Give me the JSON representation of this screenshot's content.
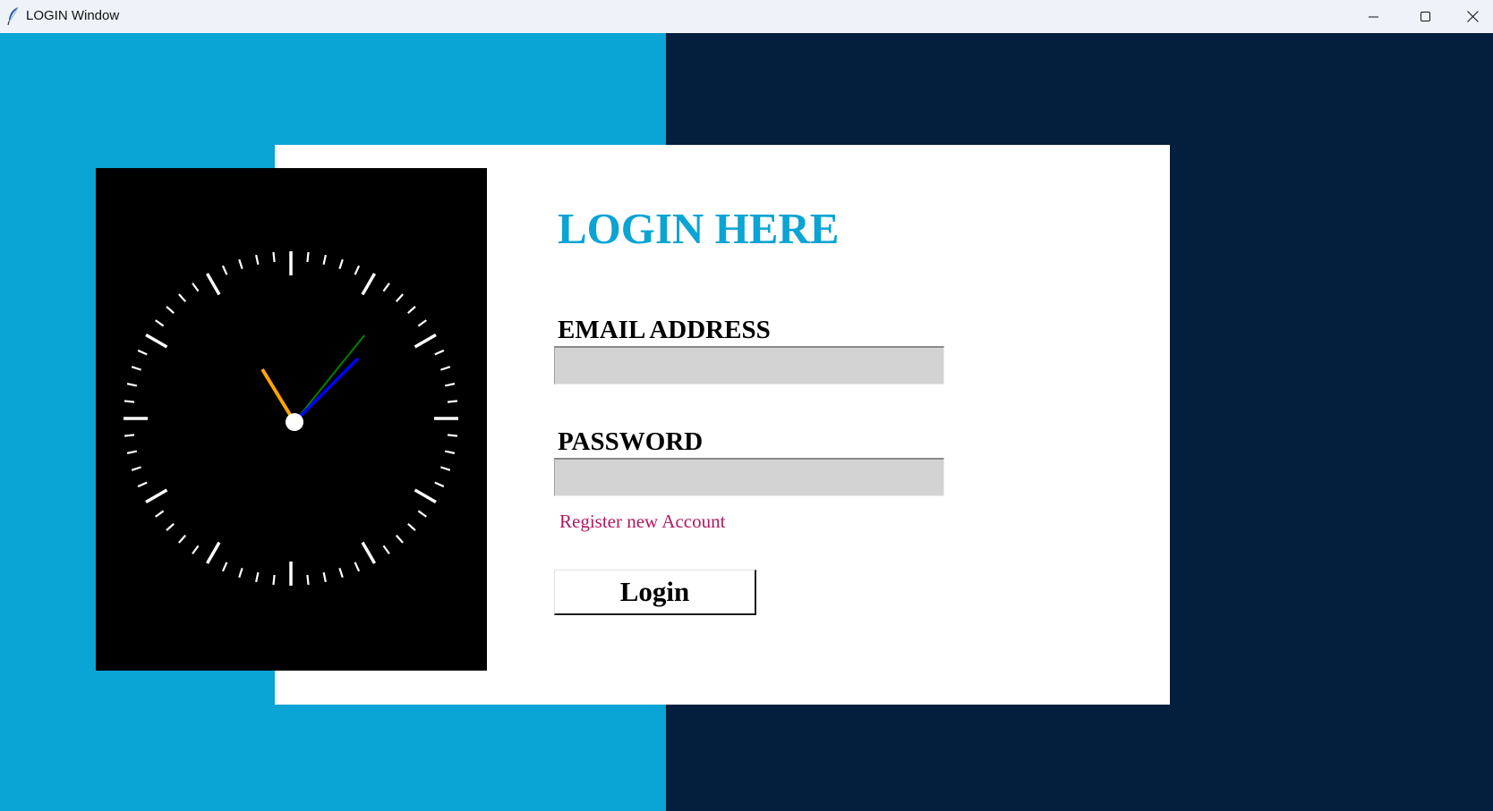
{
  "window": {
    "title": "LOGIN Window",
    "controls": {
      "minimize_icon": "minimize-icon",
      "maximize_icon": "maximize-icon",
      "close_icon": "close-icon"
    }
  },
  "colors": {
    "left_background": "#0aa4d5",
    "right_background": "#041e3d",
    "title_color": "#0aa4d5",
    "link_color": "#b2185f",
    "input_background": "#d3d3d3"
  },
  "clock": {
    "hour_hand_color": "#ffa500",
    "minute_hand_color": "#0000ff",
    "second_hand_color": "#008000"
  },
  "form": {
    "title": "LOGIN HERE",
    "email_label": "EMAIL ADDRESS",
    "email_value": "",
    "password_label": "PASSWORD",
    "password_value": "",
    "register_link": "Register new Account",
    "login_button": "Login"
  }
}
